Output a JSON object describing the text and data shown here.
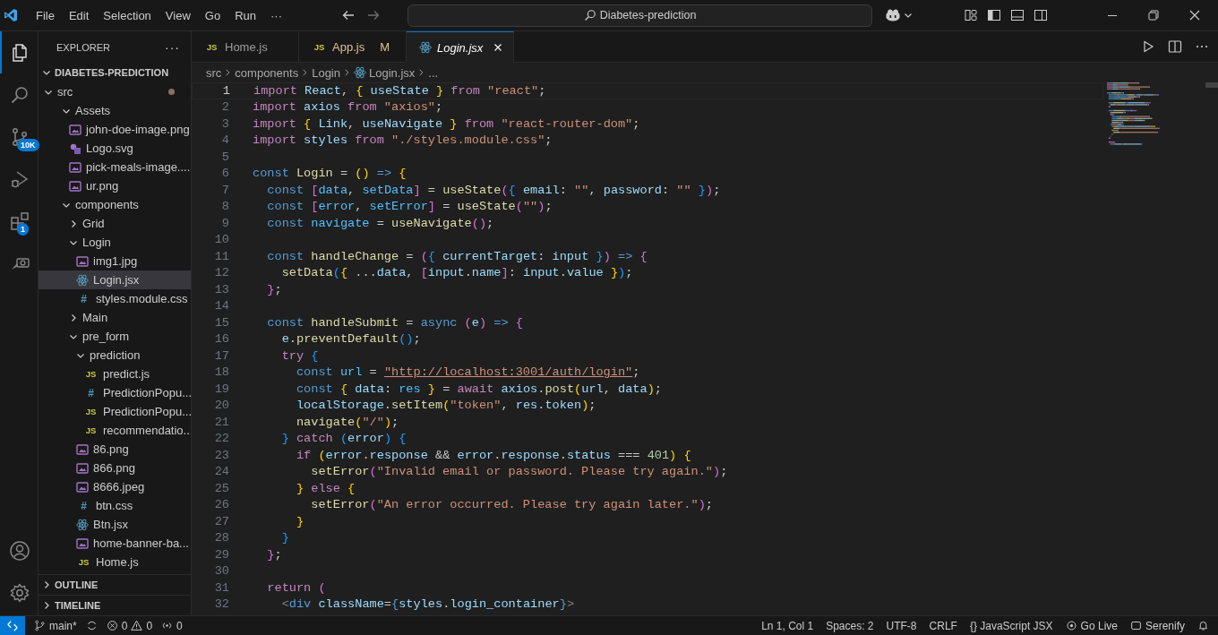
{
  "title_bar": {
    "menu": [
      "File",
      "Edit",
      "Selection",
      "View",
      "Go",
      "Run",
      "···"
    ],
    "search": "Diabetes-prediction"
  },
  "activity_bar": {
    "scm_badge": "10K",
    "extensions_badge": "1"
  },
  "sidebar": {
    "title": "EXPLORER",
    "more": "···",
    "root": {
      "label": "DIABETES-PREDICTION",
      "expanded": true
    },
    "tree": [
      {
        "label": "src",
        "kind": "folder",
        "expanded": true,
        "modified": true,
        "selected": false,
        "children": [
          {
            "label": "Assets",
            "kind": "folder",
            "expanded": true,
            "selected": false,
            "children": [
              {
                "label": "john-doe-image.png",
                "kind": "image",
                "selected": false
              },
              {
                "label": "Logo.svg",
                "kind": "vector",
                "selected": false
              },
              {
                "label": "pick-meals-image....",
                "kind": "image",
                "selected": false
              },
              {
                "label": "ur.png",
                "kind": "image",
                "selected": false
              }
            ]
          },
          {
            "label": "components",
            "kind": "folder",
            "expanded": true,
            "selected": false,
            "children": [
              {
                "label": "Grid",
                "kind": "folder",
                "expanded": false,
                "selected": false
              },
              {
                "label": "Login",
                "kind": "folder",
                "expanded": true,
                "selected": false,
                "children": [
                  {
                    "label": "img1.jpg",
                    "kind": "image",
                    "selected": false
                  },
                  {
                    "label": "Login.jsx",
                    "kind": "react",
                    "selected": true
                  },
                  {
                    "label": "styles.module.css",
                    "kind": "stylesheet",
                    "glyph": "#",
                    "selected": false
                  }
                ]
              },
              {
                "label": "Main",
                "kind": "folder",
                "expanded": false,
                "selected": false
              },
              {
                "label": "pre_form",
                "kind": "folder",
                "expanded": true,
                "selected": false,
                "children": [
                  {
                    "label": "prediction",
                    "kind": "folder",
                    "expanded": true,
                    "selected": false,
                    "children": [
                      {
                        "label": "predict.js",
                        "kind": "script",
                        "glyph": "JS",
                        "selected": false
                      },
                      {
                        "label": "PredictionPopu...",
                        "kind": "stylesheet",
                        "glyph": "#",
                        "selected": false
                      },
                      {
                        "label": "PredictionPopu...",
                        "kind": "script",
                        "glyph": "JS",
                        "selected": false
                      },
                      {
                        "label": "recommendatio...",
                        "kind": "script",
                        "glyph": "JS",
                        "selected": false
                      }
                    ]
                  },
                  {
                    "label": "86.png",
                    "kind": "image",
                    "selected": false
                  },
                  {
                    "label": "866.png",
                    "kind": "image",
                    "selected": false
                  },
                  {
                    "label": "8666.jpeg",
                    "kind": "image",
                    "selected": false
                  },
                  {
                    "label": "btn.css",
                    "kind": "stylesheet",
                    "glyph": "#",
                    "selected": false
                  },
                  {
                    "label": "Btn.jsx",
                    "kind": "react",
                    "selected": false
                  },
                  {
                    "label": "home-banner-ba...",
                    "kind": "image",
                    "selected": false
                  },
                  {
                    "label": "Home.js",
                    "kind": "script",
                    "glyph": "JS",
                    "selected": false
                  }
                ]
              }
            ]
          }
        ]
      }
    ],
    "sections": [
      {
        "label": "OUTLINE",
        "expanded": false
      },
      {
        "label": "TIMELINE",
        "expanded": false
      }
    ]
  },
  "tabs": [
    {
      "label": "Home.js",
      "kind": "script",
      "glyph": "JS",
      "selected": false
    },
    {
      "label": "App.js",
      "kind": "script",
      "glyph": "JS",
      "badge": "M",
      "selected": false
    },
    {
      "label": "Login.jsx",
      "kind": "react",
      "selected": true
    }
  ],
  "breadcrumb": [
    {
      "label": "src",
      "kind": "folder"
    },
    {
      "label": "components",
      "kind": "folder"
    },
    {
      "label": "Login",
      "kind": "folder"
    },
    {
      "label": "Login.jsx",
      "kind": "react"
    },
    {
      "label": "...",
      "kind": "more"
    }
  ],
  "code": [
    {
      "n": "1",
      "tokens": [
        {
          "kind": "keyword",
          "text": "import "
        },
        {
          "kind": "variable",
          "text": "React"
        },
        {
          "kind": "plain",
          "text": ", "
        },
        {
          "kind": "bracket1",
          "text": "{ "
        },
        {
          "kind": "variable",
          "text": "useState "
        },
        {
          "kind": "bracket1",
          "text": "} "
        },
        {
          "kind": "keyword",
          "text": "from "
        },
        {
          "kind": "string",
          "text": "\"react\""
        },
        {
          "kind": "plain",
          "text": ";"
        }
      ]
    },
    {
      "n": "2",
      "tokens": [
        {
          "kind": "keyword",
          "text": "import "
        },
        {
          "kind": "variable",
          "text": "axios "
        },
        {
          "kind": "keyword",
          "text": "from "
        },
        {
          "kind": "string",
          "text": "\"axios\""
        },
        {
          "kind": "plain",
          "text": ";"
        }
      ]
    },
    {
      "n": "3",
      "tokens": [
        {
          "kind": "keyword",
          "text": "import "
        },
        {
          "kind": "bracket1",
          "text": "{ "
        },
        {
          "kind": "variable",
          "text": "Link"
        },
        {
          "kind": "plain",
          "text": ", "
        },
        {
          "kind": "variable",
          "text": "useNavigate "
        },
        {
          "kind": "bracket1",
          "text": "} "
        },
        {
          "kind": "keyword",
          "text": "from "
        },
        {
          "kind": "string",
          "text": "\"react-router-dom\""
        },
        {
          "kind": "plain",
          "text": ";"
        }
      ]
    },
    {
      "n": "4",
      "tokens": [
        {
          "kind": "keyword",
          "text": "import "
        },
        {
          "kind": "variable",
          "text": "styles "
        },
        {
          "kind": "keyword",
          "text": "from "
        },
        {
          "kind": "string",
          "text": "\"./styles.module.css\""
        },
        {
          "kind": "plain",
          "text": ";"
        }
      ]
    },
    {
      "n": "5"
    },
    {
      "n": "6",
      "tokens": [
        {
          "kind": "storage",
          "text": "const "
        },
        {
          "kind": "function",
          "text": "Login "
        },
        {
          "kind": "plain",
          "text": "= "
        },
        {
          "kind": "bracket1",
          "text": "() "
        },
        {
          "kind": "storage",
          "text": "=> "
        },
        {
          "kind": "bracket1",
          "text": "{"
        }
      ]
    },
    {
      "n": "7",
      "tokens": [
        {
          "kind": "storage",
          "text": "  const "
        },
        {
          "kind": "bracket2",
          "text": "["
        },
        {
          "kind": "constant",
          "text": "data"
        },
        {
          "kind": "plain",
          "text": ", "
        },
        {
          "kind": "constant",
          "text": "setData"
        },
        {
          "kind": "bracket2",
          "text": "] "
        },
        {
          "kind": "plain",
          "text": "= "
        },
        {
          "kind": "function",
          "text": "useState"
        },
        {
          "kind": "bracket2",
          "text": "("
        },
        {
          "kind": "bracket3",
          "text": "{ "
        },
        {
          "kind": "variable",
          "text": "email"
        },
        {
          "kind": "plain",
          "text": ": "
        },
        {
          "kind": "string",
          "text": "\"\""
        },
        {
          "kind": "plain",
          "text": ", "
        },
        {
          "kind": "variable",
          "text": "password"
        },
        {
          "kind": "plain",
          "text": ": "
        },
        {
          "kind": "string",
          "text": "\"\" "
        },
        {
          "kind": "bracket3",
          "text": "}"
        },
        {
          "kind": "bracket2",
          "text": ")"
        },
        {
          "kind": "plain",
          "text": ";"
        }
      ]
    },
    {
      "n": "8",
      "tokens": [
        {
          "kind": "storage",
          "text": "  const "
        },
        {
          "kind": "bracket2",
          "text": "["
        },
        {
          "kind": "constant",
          "text": "error"
        },
        {
          "kind": "plain",
          "text": ", "
        },
        {
          "kind": "constant",
          "text": "setError"
        },
        {
          "kind": "bracket2",
          "text": "] "
        },
        {
          "kind": "plain",
          "text": "= "
        },
        {
          "kind": "function",
          "text": "useState"
        },
        {
          "kind": "bracket2",
          "text": "("
        },
        {
          "kind": "string",
          "text": "\"\""
        },
        {
          "kind": "bracket2",
          "text": ")"
        },
        {
          "kind": "plain",
          "text": ";"
        }
      ]
    },
    {
      "n": "9",
      "tokens": [
        {
          "kind": "storage",
          "text": "  const "
        },
        {
          "kind": "constant",
          "text": "navigate "
        },
        {
          "kind": "plain",
          "text": "= "
        },
        {
          "kind": "function",
          "text": "useNavigate"
        },
        {
          "kind": "bracket2",
          "text": "()"
        },
        {
          "kind": "plain",
          "text": ";"
        }
      ]
    },
    {
      "n": "10"
    },
    {
      "n": "11",
      "tokens": [
        {
          "kind": "storage",
          "text": "  const "
        },
        {
          "kind": "function",
          "text": "handleChange "
        },
        {
          "kind": "plain",
          "text": "= "
        },
        {
          "kind": "bracket2",
          "text": "("
        },
        {
          "kind": "bracket3",
          "text": "{ "
        },
        {
          "kind": "variable",
          "text": "currentTarget"
        },
        {
          "kind": "plain",
          "text": ": "
        },
        {
          "kind": "variable",
          "text": "input "
        },
        {
          "kind": "bracket3",
          "text": "}"
        },
        {
          "kind": "bracket2",
          "text": ") "
        },
        {
          "kind": "storage",
          "text": "=> "
        },
        {
          "kind": "bracket2",
          "text": "{"
        }
      ]
    },
    {
      "n": "12",
      "tokens": [
        {
          "kind": "function",
          "text": "    setData"
        },
        {
          "kind": "bracket3",
          "text": "("
        },
        {
          "kind": "bracket1",
          "text": "{ "
        },
        {
          "kind": "plain",
          "text": "..."
        },
        {
          "kind": "variable",
          "text": "data"
        },
        {
          "kind": "plain",
          "text": ", "
        },
        {
          "kind": "bracket2",
          "text": "["
        },
        {
          "kind": "variable",
          "text": "input"
        },
        {
          "kind": "plain",
          "text": "."
        },
        {
          "kind": "variable",
          "text": "name"
        },
        {
          "kind": "bracket2",
          "text": "]"
        },
        {
          "kind": "plain",
          "text": ": "
        },
        {
          "kind": "variable",
          "text": "input"
        },
        {
          "kind": "plain",
          "text": "."
        },
        {
          "kind": "variable",
          "text": "value "
        },
        {
          "kind": "bracket1",
          "text": "}"
        },
        {
          "kind": "bracket3",
          "text": ")"
        },
        {
          "kind": "plain",
          "text": ";"
        }
      ]
    },
    {
      "n": "13",
      "tokens": [
        {
          "kind": "bracket2",
          "text": "  }"
        },
        {
          "kind": "plain",
          "text": ";"
        }
      ]
    },
    {
      "n": "14"
    },
    {
      "n": "15",
      "tokens": [
        {
          "kind": "storage",
          "text": "  const "
        },
        {
          "kind": "function",
          "text": "handleSubmit "
        },
        {
          "kind": "plain",
          "text": "= "
        },
        {
          "kind": "storage",
          "text": "async "
        },
        {
          "kind": "bracket2",
          "text": "("
        },
        {
          "kind": "variable",
          "text": "e"
        },
        {
          "kind": "bracket2",
          "text": ") "
        },
        {
          "kind": "storage",
          "text": "=> "
        },
        {
          "kind": "bracket2",
          "text": "{"
        }
      ]
    },
    {
      "n": "16",
      "tokens": [
        {
          "kind": "variable",
          "text": "    e"
        },
        {
          "kind": "plain",
          "text": "."
        },
        {
          "kind": "function",
          "text": "preventDefault"
        },
        {
          "kind": "bracket3",
          "text": "()"
        },
        {
          "kind": "plain",
          "text": ";"
        }
      ]
    },
    {
      "n": "17",
      "tokens": [
        {
          "kind": "keyword",
          "text": "    try "
        },
        {
          "kind": "bracket3",
          "text": "{"
        }
      ]
    },
    {
      "n": "18",
      "tokens": [
        {
          "kind": "storage",
          "text": "      const "
        },
        {
          "kind": "constant",
          "text": "url "
        },
        {
          "kind": "plain",
          "text": "= "
        },
        {
          "kind": "link",
          "text": "\"http://localhost:3001/auth/login\""
        },
        {
          "kind": "plain",
          "text": ";"
        }
      ]
    },
    {
      "n": "19",
      "tokens": [
        {
          "kind": "storage",
          "text": "      const "
        },
        {
          "kind": "bracket1",
          "text": "{ "
        },
        {
          "kind": "variable",
          "text": "data"
        },
        {
          "kind": "plain",
          "text": ": "
        },
        {
          "kind": "constant",
          "text": "res "
        },
        {
          "kind": "bracket1",
          "text": "} "
        },
        {
          "kind": "plain",
          "text": "= "
        },
        {
          "kind": "keyword",
          "text": "await "
        },
        {
          "kind": "variable",
          "text": "axios"
        },
        {
          "kind": "plain",
          "text": "."
        },
        {
          "kind": "function",
          "text": "post"
        },
        {
          "kind": "bracket1",
          "text": "("
        },
        {
          "kind": "variable",
          "text": "url"
        },
        {
          "kind": "plain",
          "text": ", "
        },
        {
          "kind": "variable",
          "text": "data"
        },
        {
          "kind": "bracket1",
          "text": ")"
        },
        {
          "kind": "plain",
          "text": ";"
        }
      ]
    },
    {
      "n": "20",
      "tokens": [
        {
          "kind": "variable",
          "text": "      localStorage"
        },
        {
          "kind": "plain",
          "text": "."
        },
        {
          "kind": "function",
          "text": "setItem"
        },
        {
          "kind": "bracket1",
          "text": "("
        },
        {
          "kind": "string",
          "text": "\"token\""
        },
        {
          "kind": "plain",
          "text": ", "
        },
        {
          "kind": "variable",
          "text": "res"
        },
        {
          "kind": "plain",
          "text": "."
        },
        {
          "kind": "variable",
          "text": "token"
        },
        {
          "kind": "bracket1",
          "text": ")"
        },
        {
          "kind": "plain",
          "text": ";"
        }
      ]
    },
    {
      "n": "21",
      "tokens": [
        {
          "kind": "function",
          "text": "      navigate"
        },
        {
          "kind": "bracket1",
          "text": "("
        },
        {
          "kind": "string",
          "text": "\"/\""
        },
        {
          "kind": "bracket1",
          "text": ")"
        },
        {
          "kind": "plain",
          "text": ";"
        }
      ]
    },
    {
      "n": "22",
      "tokens": [
        {
          "kind": "bracket3",
          "text": "    } "
        },
        {
          "kind": "keyword",
          "text": "catch "
        },
        {
          "kind": "bracket3",
          "text": "("
        },
        {
          "kind": "variable",
          "text": "error"
        },
        {
          "kind": "bracket3",
          "text": ") {"
        }
      ]
    },
    {
      "n": "23",
      "tokens": [
        {
          "kind": "keyword",
          "text": "      if "
        },
        {
          "kind": "bracket1",
          "text": "("
        },
        {
          "kind": "variable",
          "text": "error"
        },
        {
          "kind": "plain",
          "text": "."
        },
        {
          "kind": "variable",
          "text": "response "
        },
        {
          "kind": "plain",
          "text": "&& "
        },
        {
          "kind": "variable",
          "text": "error"
        },
        {
          "kind": "plain",
          "text": "."
        },
        {
          "kind": "variable",
          "text": "response"
        },
        {
          "kind": "plain",
          "text": "."
        },
        {
          "kind": "variable",
          "text": "status "
        },
        {
          "kind": "plain",
          "text": "=== "
        },
        {
          "kind": "number",
          "text": "401"
        },
        {
          "kind": "bracket1",
          "text": ") {"
        }
      ]
    },
    {
      "n": "24",
      "tokens": [
        {
          "kind": "function",
          "text": "        setError"
        },
        {
          "kind": "bracket2",
          "text": "("
        },
        {
          "kind": "string",
          "text": "\"Invalid email or password. Please try again.\""
        },
        {
          "kind": "bracket2",
          "text": ")"
        },
        {
          "kind": "plain",
          "text": ";"
        }
      ]
    },
    {
      "n": "25",
      "tokens": [
        {
          "kind": "bracket1",
          "text": "      } "
        },
        {
          "kind": "keyword",
          "text": "else "
        },
        {
          "kind": "bracket1",
          "text": "{"
        }
      ]
    },
    {
      "n": "26",
      "tokens": [
        {
          "kind": "function",
          "text": "        setError"
        },
        {
          "kind": "bracket2",
          "text": "("
        },
        {
          "kind": "string",
          "text": "\"An error occurred. Please try again later.\""
        },
        {
          "kind": "bracket2",
          "text": ")"
        },
        {
          "kind": "plain",
          "text": ";"
        }
      ]
    },
    {
      "n": "27",
      "tokens": [
        {
          "kind": "bracket1",
          "text": "      }"
        }
      ]
    },
    {
      "n": "28",
      "tokens": [
        {
          "kind": "bracket3",
          "text": "    }"
        }
      ]
    },
    {
      "n": "29",
      "tokens": [
        {
          "kind": "bracket2",
          "text": "  }"
        },
        {
          "kind": "plain",
          "text": ";"
        }
      ]
    },
    {
      "n": "30"
    },
    {
      "n": "31",
      "tokens": [
        {
          "kind": "keyword",
          "text": "  return "
        },
        {
          "kind": "bracket2",
          "text": "("
        }
      ]
    },
    {
      "n": "32",
      "tokens": [
        {
          "kind": "tag",
          "text": "    <"
        },
        {
          "kind": "storage",
          "text": "div "
        },
        {
          "kind": "variable",
          "text": "className"
        },
        {
          "kind": "plain",
          "text": "="
        },
        {
          "kind": "storage",
          "text": "{"
        },
        {
          "kind": "variable",
          "text": "styles"
        },
        {
          "kind": "plain",
          "text": "."
        },
        {
          "kind": "variable",
          "text": "login_container"
        },
        {
          "kind": "storage",
          "text": "}"
        },
        {
          "kind": "tag",
          "text": ">"
        }
      ]
    }
  ],
  "status_bar": {
    "branch": "main*",
    "errors": "0",
    "warnings": "0",
    "ports": "0",
    "right": [
      {
        "kind": "text",
        "label": "Ln 1, Col 1"
      },
      {
        "kind": "text",
        "label": "Spaces: 2"
      },
      {
        "kind": "text",
        "label": "UTF-8"
      },
      {
        "kind": "text",
        "label": "CRLF"
      },
      {
        "kind": "text",
        "label": "{} JavaScript JSX"
      },
      {
        "kind": "golive",
        "label": "Go Live"
      },
      {
        "kind": "ext",
        "label": "Serenify"
      },
      {
        "kind": "bell"
      }
    ]
  }
}
